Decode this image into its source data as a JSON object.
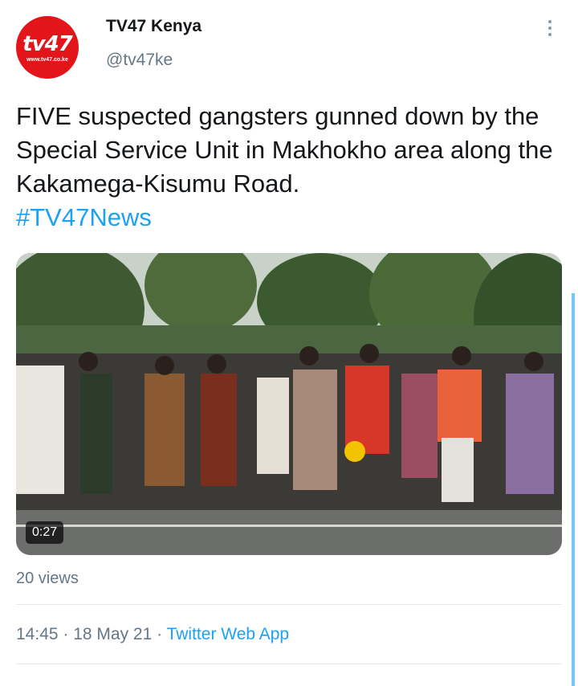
{
  "author": {
    "display_name": "TV47 Kenya",
    "handle": "@tv47ke",
    "avatar_logo": "tv47",
    "avatar_url_text": "www.tv47.co.ke",
    "avatar_color": "#e3151b"
  },
  "more_icon": "more-vertical-icon",
  "tweet": {
    "text": "FIVE suspected gangsters gunned down by the Special Service Unit in Makhokho area along the Kakamega-Kisumu Road.",
    "hashtag": "#TV47News"
  },
  "media": {
    "type": "video",
    "duration": "0:27"
  },
  "stats": {
    "views": "20 views"
  },
  "meta": {
    "time": "14:45",
    "separator": " · ",
    "date": "18 May 21",
    "source": "Twitter Web App"
  },
  "colors": {
    "link": "#1da1f2",
    "secondary_text": "#657786",
    "primary_text": "#14171a"
  }
}
